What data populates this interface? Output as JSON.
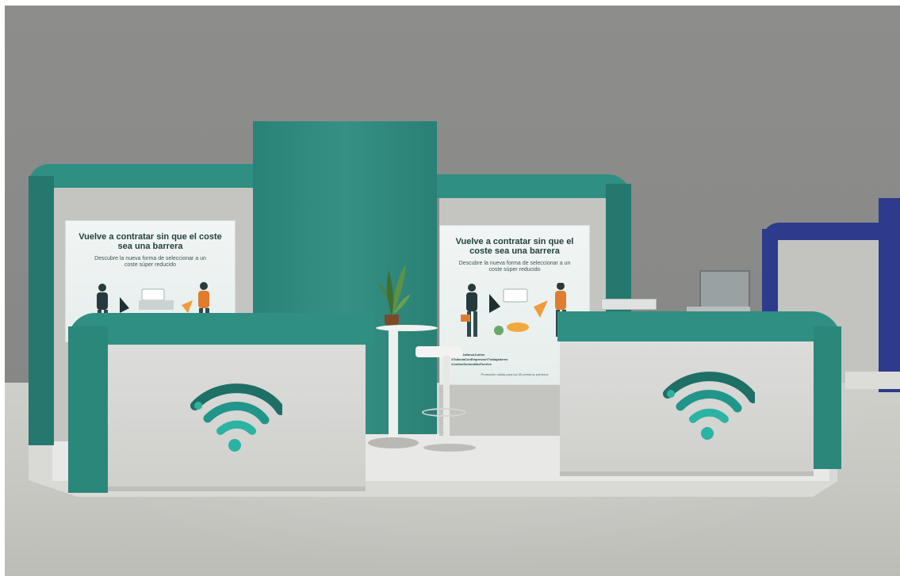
{
  "scene": {
    "colors": {
      "booth_teal": "#2e8f82",
      "wall_gray": "#8a8a88",
      "floor": "#c8c8c3",
      "neighbor_booth_blue": "#2d3b8c",
      "logo_teal": "#1f8f82"
    }
  },
  "poster_left": {
    "title": "Vuelve a contratar sin que el coste sea una barrera",
    "subtitle": "Descubre la nueva forma de seleccionar a un coste súper reducido"
  },
  "poster_right": {
    "title": "Vuelve a contratar sin que el coste sea una barrera",
    "subtitle": "Descubre la nueva forma de seleccionar a un coste súper reducido",
    "hashtags": [
      "#AhoraSalimosJuntos",
      "#TodaviaConEmpresasYTrabajadores",
      "#JuntosSomosMasFuertes"
    ],
    "footer": "Promoción válida para los 50 primeros primeros"
  },
  "logo": {
    "icon": "wifi-logo-icon"
  }
}
